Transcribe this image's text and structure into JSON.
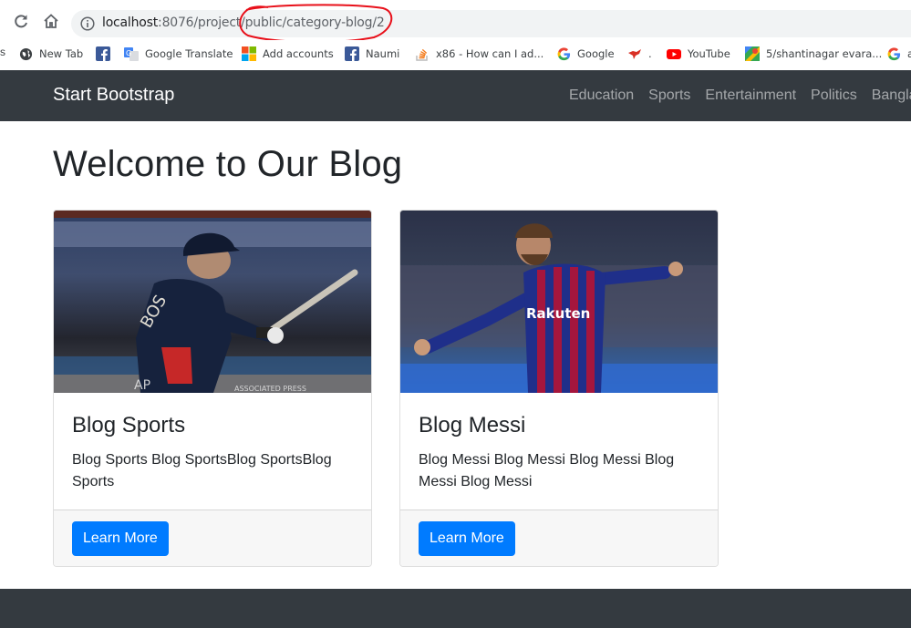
{
  "browser": {
    "url_host": "localhost",
    "url_path": ":8076/project/public/category-blog/2",
    "bookmarks": [
      {
        "label": "New Tab",
        "icon": "globe-icon"
      },
      {
        "label": "Google Translate",
        "icon": "google-translate-icon"
      },
      {
        "label": "Add accounts",
        "icon": "microsoft-icon"
      },
      {
        "label": "Naumi",
        "icon": "facebook-icon"
      },
      {
        "label": "x86 - How can I ad...",
        "icon": "stackoverflow-icon"
      },
      {
        "label": "Google",
        "icon": "google-icon"
      },
      {
        "label": ".",
        "icon": "bird-icon"
      },
      {
        "label": "YouTube",
        "icon": "youtube-icon"
      },
      {
        "label": "5/shantinagar evara...",
        "icon": "maps-icon"
      },
      {
        "label": "a",
        "icon": "google-icon"
      }
    ],
    "bookmark_left_fragment": "s"
  },
  "navbar": {
    "brand": "Start Bootstrap",
    "links": [
      "Education",
      "Sports",
      "Entertainment",
      "Politics",
      "Bangla"
    ]
  },
  "main": {
    "title": "Welcome to Our Blog",
    "cards": [
      {
        "title": "Blog Sports",
        "text": "Blog Sports Blog SportsBlog SportsBlog Sports",
        "button": "Learn More",
        "image": "baseball-player-photo",
        "image_caption": "ASSOCIATED PRESS",
        "image_mark": "AP"
      },
      {
        "title": "Blog Messi",
        "text": "Blog Messi Blog Messi Blog Messi Blog Messi Blog Messi",
        "button": "Learn More",
        "image": "footballer-celebrating-photo",
        "image_shirt_text": "Rakuten"
      }
    ]
  },
  "colors": {
    "navbar_bg": "#343a40",
    "primary": "#007bff",
    "annotation": "#e8101a"
  }
}
